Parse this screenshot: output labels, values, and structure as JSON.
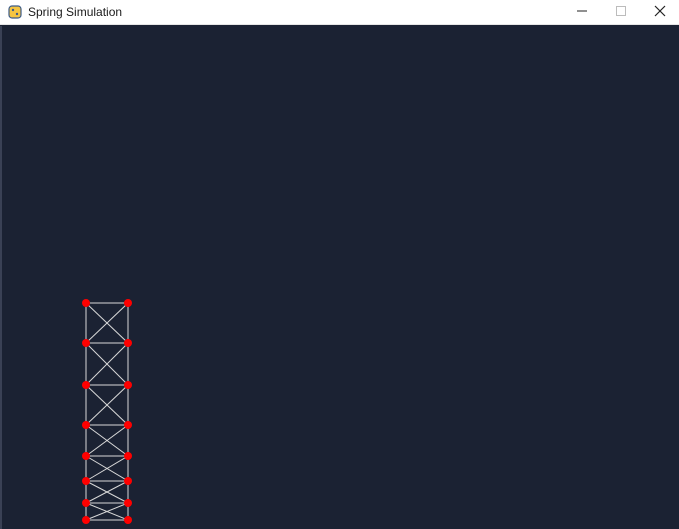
{
  "window": {
    "title": "Spring Simulation",
    "app_icon": "python-icon",
    "controls": {
      "minimize_icon": "minimize-icon",
      "maximize_icon": "maximize-icon",
      "close_icon": "close-icon"
    }
  },
  "simulation": {
    "background_color": "#1b2233",
    "node_color": "#ff0000",
    "spring_color": "#d8d8d8"
  }
}
